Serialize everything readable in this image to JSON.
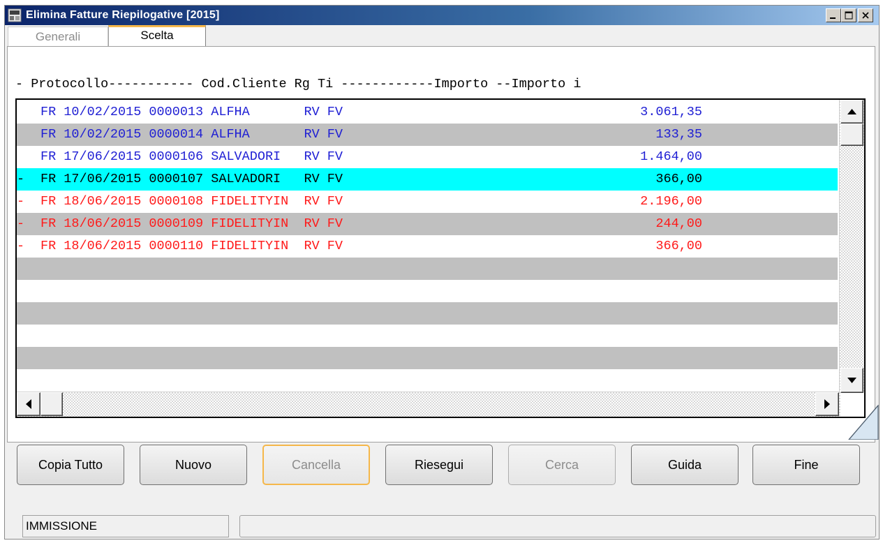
{
  "window": {
    "title": "Elimina Fatture Riepilogative [2015]",
    "controls": {
      "minimize": "minimize",
      "maximize": "maximize",
      "close": "close"
    }
  },
  "tabs": [
    {
      "label": "Generali",
      "active": false
    },
    {
      "label": "Scelta",
      "active": true
    }
  ],
  "list": {
    "header": "- Protocollo----------- Cod.Cliente Rg Ti ------------Importo --Importo i",
    "rows": [
      {
        "mark": " ",
        "text": "FR 10/02/2015 0000013 ALFHA       RV FV",
        "amount": "3.061,35",
        "color": "#1f1fd4",
        "style": "normal"
      },
      {
        "mark": " ",
        "text": "FR 10/02/2015 0000014 ALFHA       RV FV",
        "amount": "133,35",
        "color": "#1f1fd4",
        "style": "alt"
      },
      {
        "mark": " ",
        "text": "FR 17/06/2015 0000106 SALVADORI   RV FV",
        "amount": "1.464,00",
        "color": "#1f1fd4",
        "style": "normal"
      },
      {
        "mark": "-",
        "text": "FR 17/06/2015 0000107 SALVADORI   RV FV",
        "amount": "366,00",
        "color": "#000000",
        "style": "sel"
      },
      {
        "mark": "-",
        "text": "FR 18/06/2015 0000108 FIDELITYIN  RV FV",
        "amount": "2.196,00",
        "color": "#ff1a1a",
        "style": "normal"
      },
      {
        "mark": "-",
        "text": "FR 18/06/2015 0000109 FIDELITYIN  RV FV",
        "amount": "244,00",
        "color": "#ff1a1a",
        "style": "alt"
      },
      {
        "mark": "-",
        "text": "FR 18/06/2015 0000110 FIDELITYIN  RV FV",
        "amount": "366,00",
        "color": "#ff1a1a",
        "style": "normal"
      }
    ]
  },
  "buttons": {
    "copia_tutto": "Copia Tutto",
    "nuovo": "Nuovo",
    "cancella": "Cancella",
    "riesegui": "Riesegui",
    "cerca": "Cerca",
    "guida": "Guida",
    "fine": "Fine"
  },
  "status": {
    "mode": "IMMISSIONE",
    "message": ""
  },
  "colors": {
    "selection": "#00ffff",
    "alt_row": "#c0c0c0",
    "focus": "#f5b74a",
    "blue_text": "#1f1fd4",
    "red_text": "#ff1a1a"
  },
  "icons": {
    "app": "app-icon",
    "scroll_up": "arrow-up-icon",
    "scroll_down": "arrow-down-icon",
    "scroll_left": "arrow-left-icon",
    "scroll_right": "arrow-right-icon"
  }
}
